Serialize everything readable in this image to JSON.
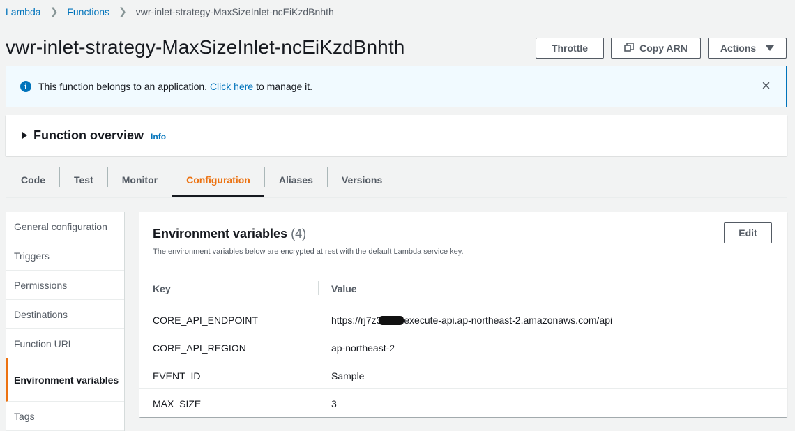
{
  "breadcrumb": {
    "items": [
      "Lambda",
      "Functions"
    ],
    "current": "vwr-inlet-strategy-MaxSizeInlet-ncEiKzdBnhth"
  },
  "page": {
    "title": "vwr-inlet-strategy-MaxSizeInlet-ncEiKzdBnhth"
  },
  "header_buttons": {
    "throttle": "Throttle",
    "copy_arn": "Copy ARN",
    "actions": "Actions"
  },
  "flash": {
    "icon": "info-icon",
    "text_before": "This function belongs to an application.",
    "link": "Click here",
    "text_after": "to manage it.",
    "close": "×"
  },
  "overview": {
    "title": "Function overview",
    "info": "Info"
  },
  "tabs": [
    "Code",
    "Test",
    "Monitor",
    "Configuration",
    "Aliases",
    "Versions"
  ],
  "active_tab": "Configuration",
  "sidenav": {
    "items": [
      "General configuration",
      "Triggers",
      "Permissions",
      "Destinations",
      "Function URL",
      "Environment variables",
      "Tags"
    ],
    "active": "Environment variables"
  },
  "env_panel": {
    "title": "Environment variables",
    "count": "(4)",
    "description": "The environment variables below are encrypted at rest with the default Lambda service key.",
    "edit_label": "Edit",
    "columns": [
      "Key",
      "Value"
    ],
    "rows": [
      {
        "key": "CORE_API_ENDPOINT",
        "value_prefix": "https://rj7z3",
        "value_suffix": ".execute-api.ap-northeast-2.amazonaws.com/api"
      },
      {
        "key": "CORE_API_REGION",
        "value": "ap-northeast-2"
      },
      {
        "key": "EVENT_ID",
        "value": "Sample"
      },
      {
        "key": "MAX_SIZE",
        "value": "3"
      }
    ]
  },
  "colors": {
    "link": "#0073bb",
    "accent": "#ec7211",
    "text": "#16191f",
    "flash_bg": "#f1faff"
  }
}
